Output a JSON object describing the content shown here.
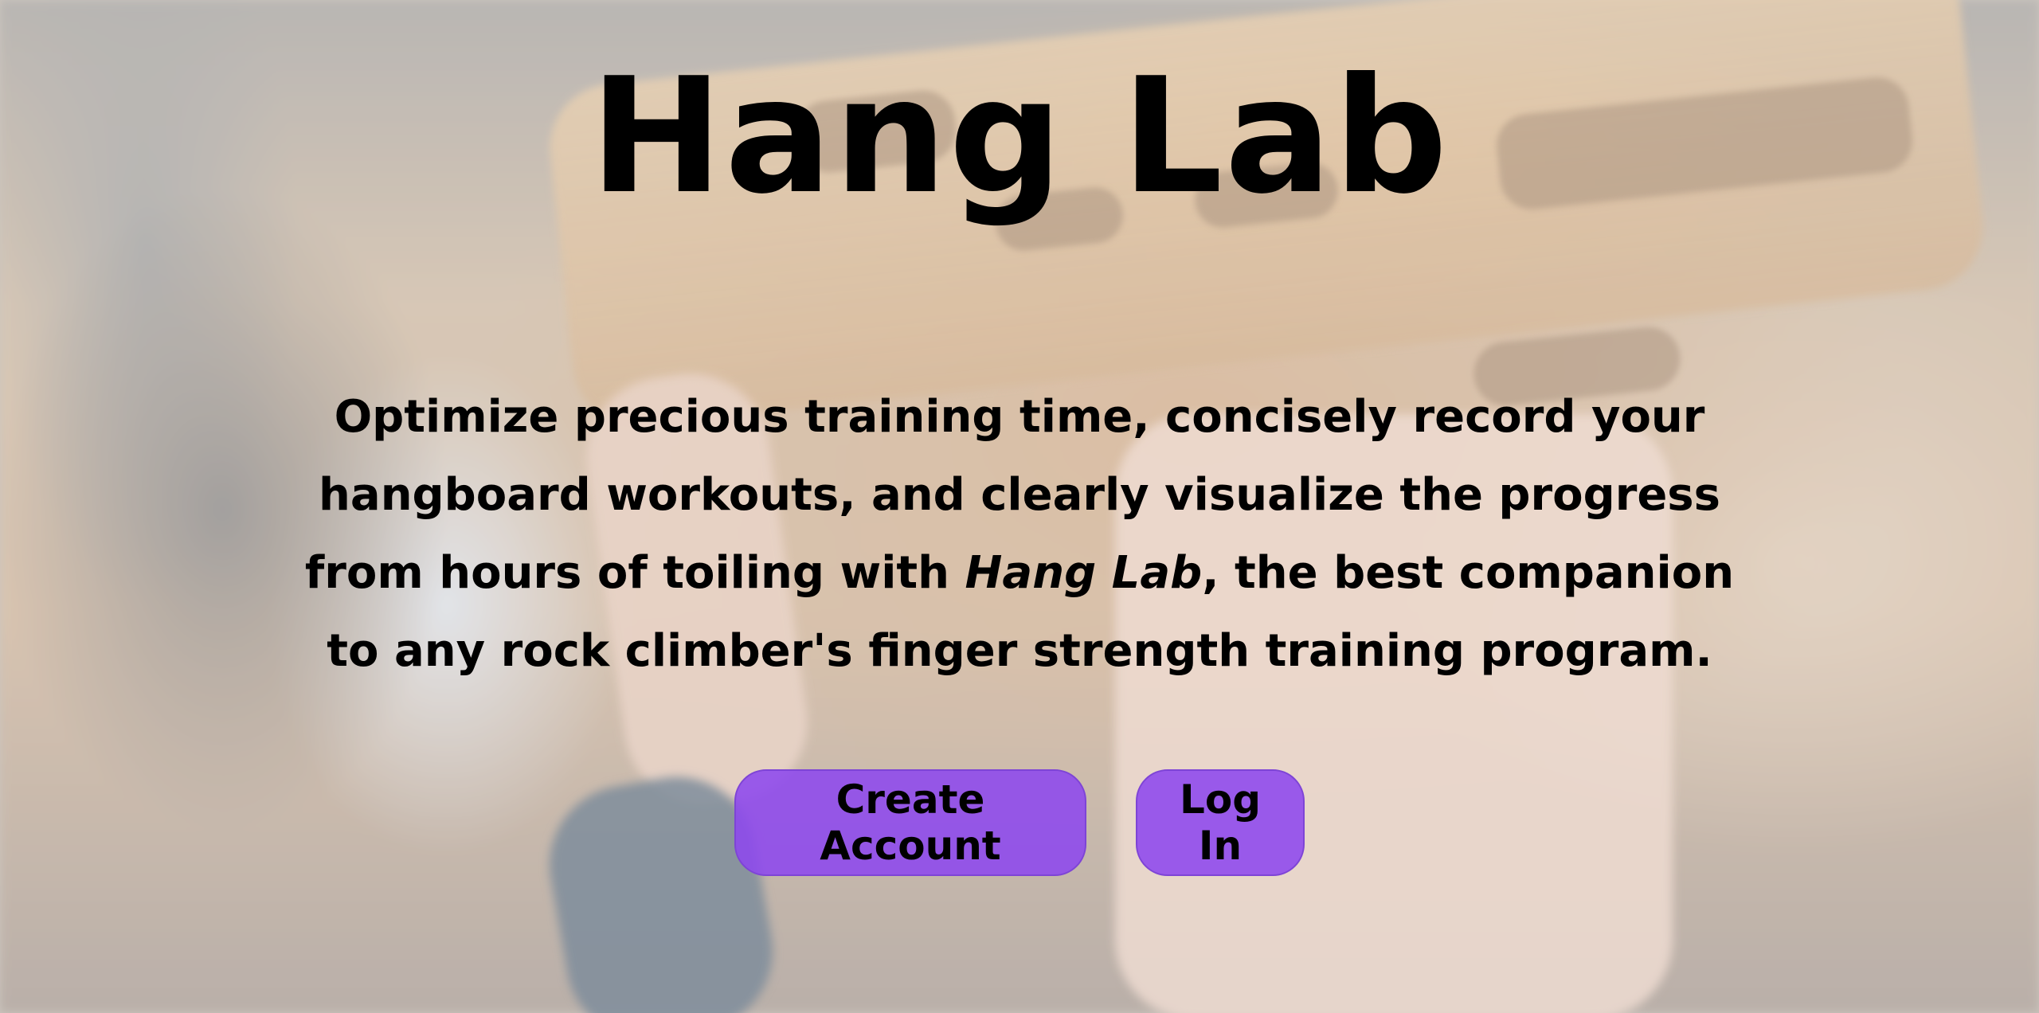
{
  "hero": {
    "title": "Hang Lab",
    "tagline_part1": "Optimize precious training time, concisely record your hangboard workouts, and clearly visualize the progress from hours of toiling with ",
    "tagline_brand": "Hang Lab",
    "tagline_part2": ", the best companion to any rock climber's finger strength training program.",
    "background_image": "hangboard-photo"
  },
  "actions": {
    "create_account_label": "Create Account",
    "log_in_label": "Log In"
  },
  "colors": {
    "button_fill": "#8d48ee",
    "button_border": "#7e44d6",
    "text": "#000000"
  }
}
